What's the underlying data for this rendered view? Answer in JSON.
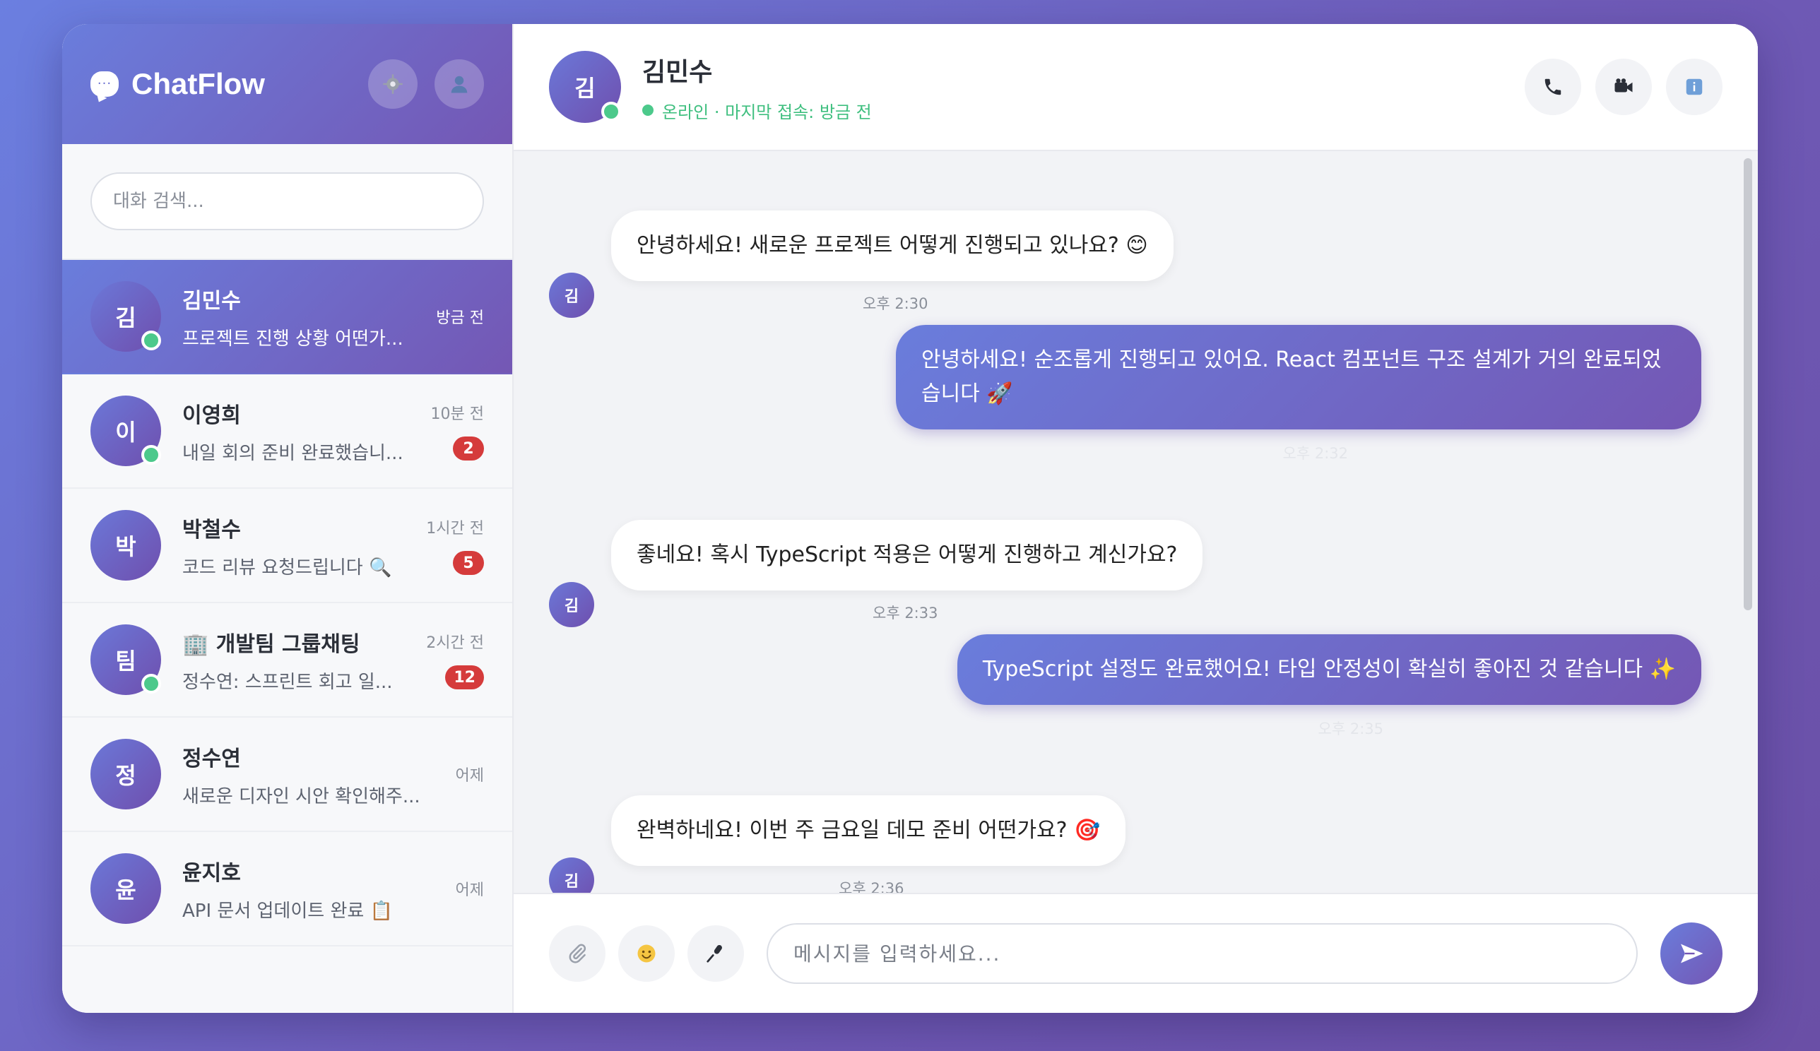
{
  "app": {
    "name": "ChatFlow",
    "brand_icon_text": "···"
  },
  "sidebar": {
    "search_placeholder": "대화 검색...",
    "conversations": [
      {
        "initial": "김",
        "name": "김민수",
        "preview": "프로젝트 진행 상황 어떤가...",
        "time": "방금 전",
        "badge": "",
        "online": true,
        "active": true
      },
      {
        "initial": "이",
        "name": "이영희",
        "preview": "내일 회의 준비 완료했습니...",
        "time": "10분 전",
        "badge": "2",
        "online": true,
        "active": false
      },
      {
        "initial": "박",
        "name": "박철수",
        "preview": "코드 리뷰 요청드립니다 🔍",
        "time": "1시간 전",
        "badge": "5",
        "online": false,
        "active": false
      },
      {
        "initial": "팀",
        "name": "🏢 개발팀 그룹채팅",
        "preview": "정수연: 스프린트 회고 일...",
        "time": "2시간 전",
        "badge": "12",
        "online": true,
        "active": false
      },
      {
        "initial": "정",
        "name": "정수연",
        "preview": "새로운 디자인 시안 확인해주...",
        "time": "어제",
        "badge": "",
        "online": false,
        "active": false
      },
      {
        "initial": "윤",
        "name": "윤지호",
        "preview": "API 문서 업데이트 완료 📋",
        "time": "어제",
        "badge": "",
        "online": false,
        "active": false
      }
    ]
  },
  "chat": {
    "contact_initial": "김",
    "contact_name": "김민수",
    "contact_status": "온라인 · 마지막 접속: 방금 전",
    "messages": [
      {
        "direction": "in",
        "text": "안녕하세요! 새로운 프로젝트 어떻게 진행되고 있나요? 😊",
        "time": "오후 2:30"
      },
      {
        "direction": "out",
        "text": "안녕하세요! 순조롭게 진행되고 있어요. React 컴포넌트 구조 설계가 거의 완료되었습니다 🚀",
        "time": "오후 2:32"
      },
      {
        "direction": "in",
        "text": "좋네요! 혹시 TypeScript 적용은 어떻게 진행하고 계신가요?",
        "time": "오후 2:33"
      },
      {
        "direction": "out",
        "text": "TypeScript 설정도 완료했어요! 타입 안정성이 확실히 좋아진 것 같습니다 ✨",
        "time": "오후 2:35"
      },
      {
        "direction": "in",
        "text": "완벽하네요! 이번 주 금요일 데모 준비 어떤가요? 🎯",
        "time": "오후 2:36"
      }
    ],
    "input_placeholder": "메시지를 입력하세요..."
  },
  "colors": {
    "accent_start": "#6a7ddc",
    "accent_end": "#7457b4",
    "online": "#4cc98b",
    "badge": "#d53b3b"
  },
  "icons": {
    "header": [
      "gear-icon",
      "user-icon"
    ],
    "chat_actions": [
      "phone-icon",
      "video-icon",
      "info-icon"
    ],
    "composer": [
      "paperclip-icon",
      "emoji-icon",
      "microphone-icon",
      "send-icon"
    ]
  }
}
